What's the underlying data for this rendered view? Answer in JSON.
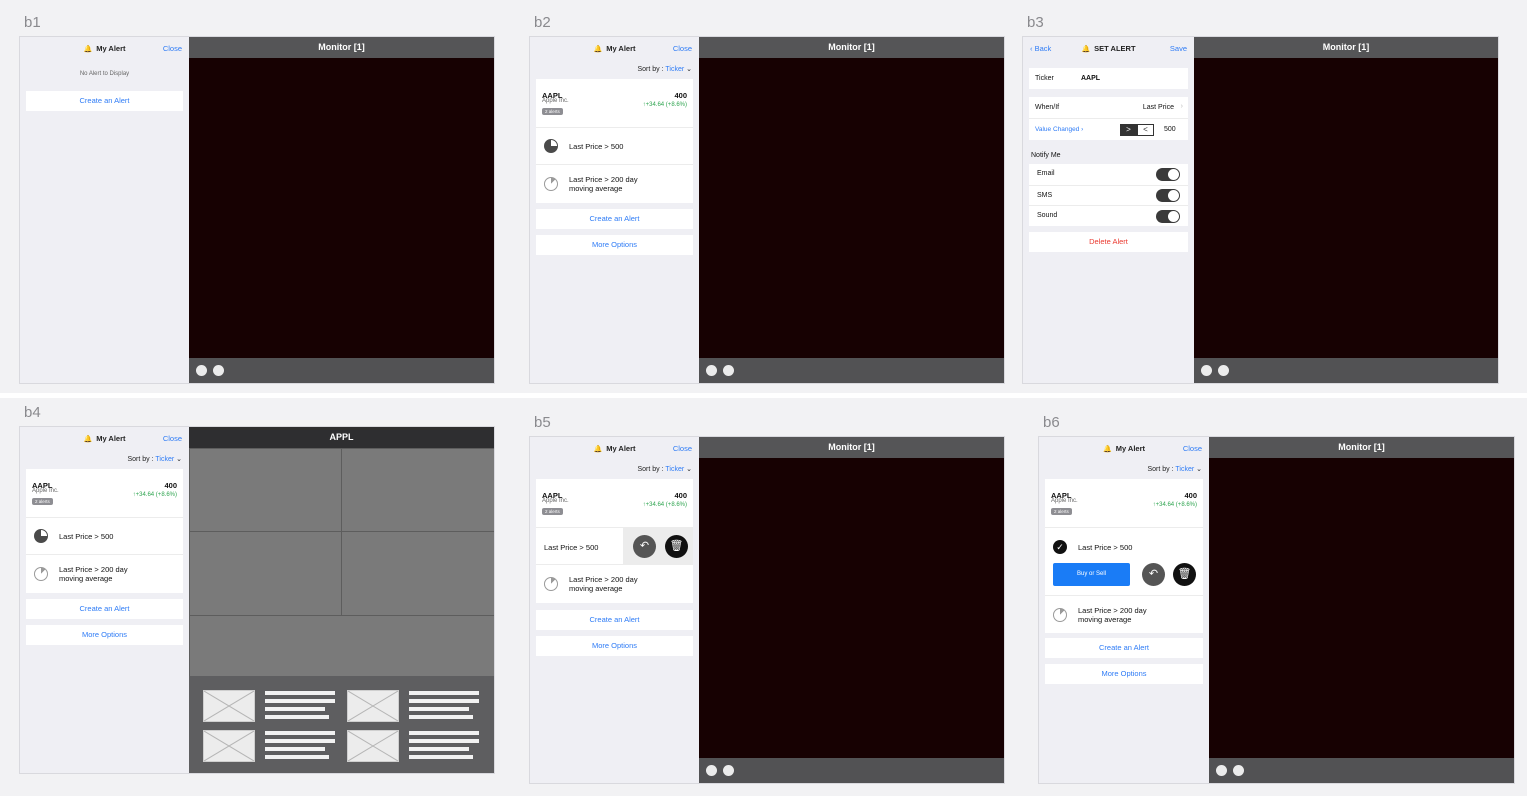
{
  "frames": [
    {
      "id": "b1"
    },
    {
      "id": "b2"
    },
    {
      "id": "b3"
    },
    {
      "id": "b4"
    },
    {
      "id": "b5"
    },
    {
      "id": "b6"
    }
  ],
  "labels": {
    "b1": "b1",
    "b2": "b2",
    "b3": "b3",
    "b4": "b4",
    "b5": "b5",
    "b6": "b6"
  },
  "common": {
    "my_alert": "My Alert",
    "close": "Close",
    "monitor": "Monitor [1]",
    "sort_by": "Sort by : ",
    "sort_value": "Ticker",
    "create_alert": "Create an Alert",
    "more_options": "More Options"
  },
  "b1": {
    "empty_text": "No Alert to Display"
  },
  "stock": {
    "ticker": "AAPL",
    "company": "Apple Inc.",
    "badge": "2 alerts",
    "price": "400",
    "change": "↑+34.64 (+8.6%)"
  },
  "alerts": {
    "a1": "Last Price > 500",
    "a2_line1": "Last Price > 200 day",
    "a2_line2": "moving average"
  },
  "b3": {
    "back": "Back",
    "title": "SET ALERT",
    "save": "Save",
    "ticker_label": "Ticker",
    "ticker_value": "AAPL",
    "when_label": "When/If",
    "when_value": "Last Price",
    "value_changed": "Value Changed",
    "op_gt": ">",
    "op_lt": "<",
    "threshold": "500",
    "notify": "Notify Me",
    "email": "Email",
    "sms": "SMS",
    "sound": "Sound",
    "delete": "Delete Alert"
  },
  "b4": {
    "monitor_title": "APPL"
  },
  "b6": {
    "buy_sell": "Buy or Sell"
  },
  "colors": {
    "accent": "#2f7cf6",
    "positive": "#2ea44f",
    "danger": "#ea3a30",
    "monitor_bg": "#170102"
  },
  "icons": {
    "bell": "bell-icon",
    "reply": "reply-icon",
    "trash": "trash-icon",
    "check": "check-icon",
    "chevron": "chevron-right-icon"
  }
}
